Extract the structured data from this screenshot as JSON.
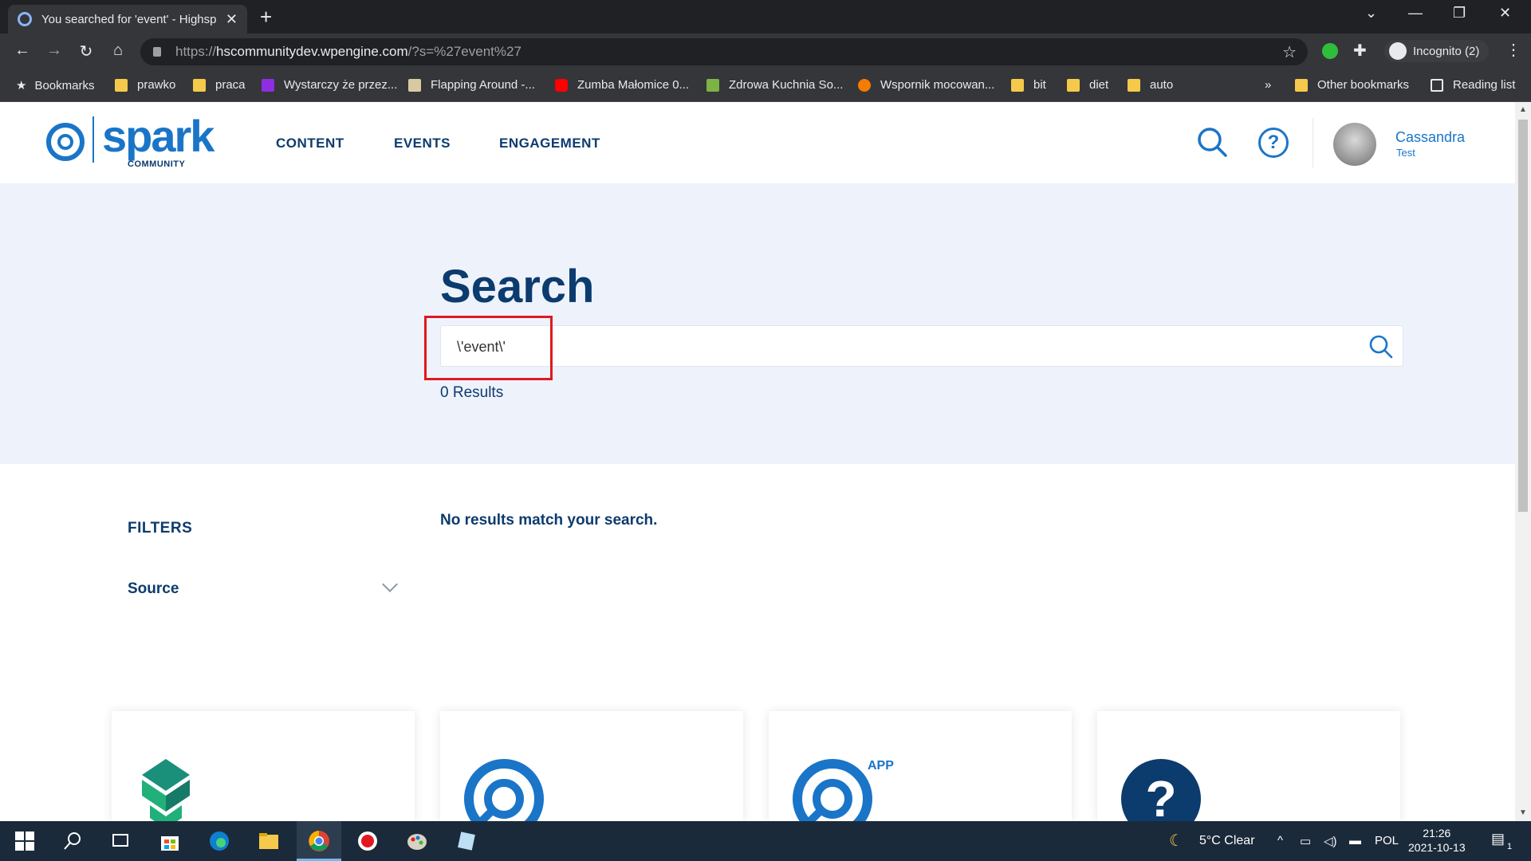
{
  "browser": {
    "tab_title": "You searched for 'event' - Highsp",
    "url_prefix": "https://",
    "url_host": "hscommunitydev.wpengine.com",
    "url_rest": "/?s=%27event%27",
    "profile_label": "Incognito (2)",
    "icons": {
      "new_tab": "+",
      "close": "✕",
      "back": "←",
      "forward": "→",
      "reload": "↻",
      "home": "⌂",
      "star": "☆",
      "menu": "⋮",
      "chevron": "⌄",
      "minimize": "—",
      "restore": "❐",
      "window_close": "✕",
      "more": "»"
    }
  },
  "bookmarks": {
    "items": [
      "Bookmarks",
      "prawko",
      "praca",
      "Wystarczy że przez...",
      "Flapping Around -...",
      "Zumba Małomice 0...",
      "Zdrowa Kuchnia So...",
      "Wspornik mocowan...",
      "bit",
      "diet",
      "auto"
    ],
    "other": "Other bookmarks",
    "reading_list": "Reading list"
  },
  "site": {
    "logo_text": "spark",
    "logo_sub": "COMMUNITY",
    "nav": [
      "CONTENT",
      "EVENTS",
      "ENGAGEMENT"
    ],
    "user_name": "Cassandra",
    "user_sub": "Test",
    "help_glyph": "?"
  },
  "search": {
    "title": "Search",
    "value": "\\'event\\'",
    "result_count": "0 Results"
  },
  "filters": {
    "title": "FILTERS",
    "source_label": "Source"
  },
  "results": {
    "empty_message": "No results match your search."
  },
  "cards": {
    "app_badge": "APP",
    "question_glyph": "?"
  },
  "taskbar": {
    "weather": "5°C  Clear",
    "language": "POL",
    "time": "21:26",
    "date": "2021-10-13",
    "notifications": "1"
  },
  "colors": {
    "brand_blue": "#1a75c8",
    "brand_navy": "#0c3b6e",
    "hero_bg": "#eef2fb",
    "highlight_red": "#e0191f"
  }
}
